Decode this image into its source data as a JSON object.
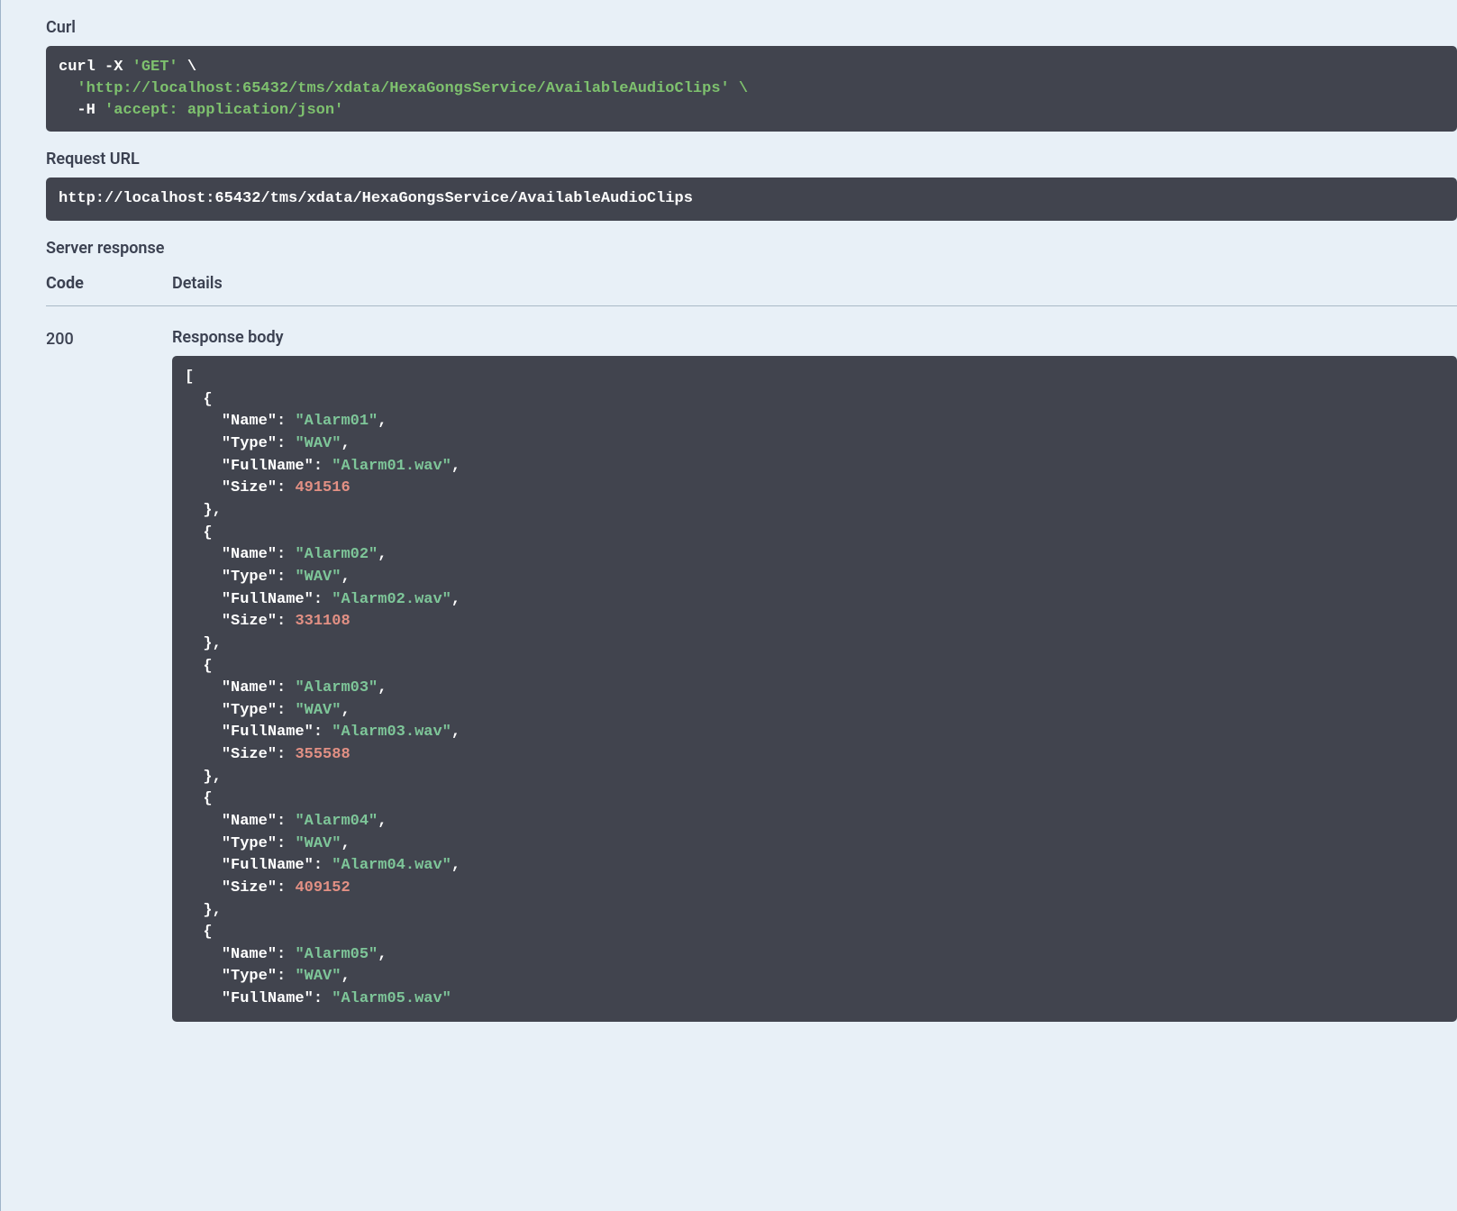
{
  "labels": {
    "curl": "Curl",
    "request_url": "Request URL",
    "server_response": "Server response",
    "code": "Code",
    "details": "Details",
    "response_body": "Response body"
  },
  "curl": {
    "command": "curl -X 'GET' \\",
    "url_line": "  'http://localhost:65432/tms/xdata/HexaGongsService/AvailableAudioClips' \\",
    "header_prefix": "  -H '",
    "header_value": "accept: application/json",
    "header_suffix": "'"
  },
  "request_url": "http://localhost:65432/tms/xdata/HexaGongsService/AvailableAudioClips",
  "response": {
    "status_code": "200",
    "body": [
      {
        "Name": "Alarm01",
        "Type": "WAV",
        "FullName": "Alarm01.wav",
        "Size": 491516
      },
      {
        "Name": "Alarm02",
        "Type": "WAV",
        "FullName": "Alarm02.wav",
        "Size": 331108
      },
      {
        "Name": "Alarm03",
        "Type": "WAV",
        "FullName": "Alarm03.wav",
        "Size": 355588
      },
      {
        "Name": "Alarm04",
        "Type": "WAV",
        "FullName": "Alarm04.wav",
        "Size": 409152
      },
      {
        "Name": "Alarm05",
        "Type": "WAV",
        "FullName": "Alarm05.wav"
      }
    ]
  },
  "colors": {
    "page_bg": "#e8f0f7",
    "code_bg": "#41444e",
    "string_green": "#7ec699",
    "number_red": "#e29084",
    "text_dark": "#3b4151"
  }
}
